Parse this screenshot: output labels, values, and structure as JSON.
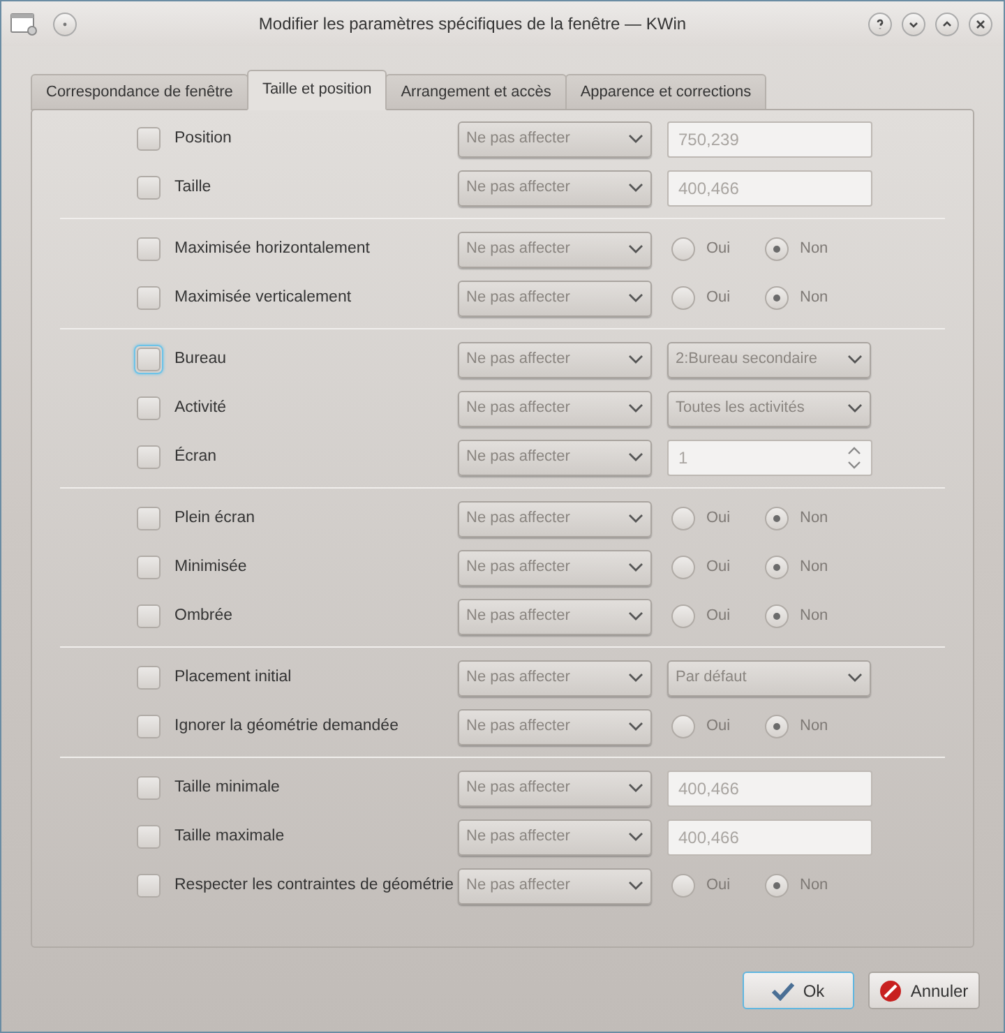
{
  "window": {
    "title": "Modifier les paramètres spécifiques de la fenêtre — KWin"
  },
  "tabs": [
    {
      "label": "Correspondance de fenêtre",
      "selected": false
    },
    {
      "label": "Taille et position",
      "selected": true
    },
    {
      "label": "Arrangement et accès",
      "selected": false
    },
    {
      "label": "Apparence et corrections",
      "selected": false
    }
  ],
  "groups": [
    {
      "rows": [
        {
          "label": "Position",
          "checked": false,
          "focused": false,
          "policy": "Ne pas affecter",
          "kind": "text",
          "value": "750,239"
        },
        {
          "label": "Taille",
          "checked": false,
          "focused": false,
          "policy": "Ne pas affecter",
          "kind": "text",
          "value": "400,466"
        }
      ]
    },
    {
      "rows": [
        {
          "label": "Maximisée horizontalement",
          "checked": false,
          "focused": false,
          "policy": "Ne pas affecter",
          "kind": "radio",
          "options": [
            {
              "label": "Oui",
              "selected": false
            },
            {
              "label": "Non",
              "selected": true
            }
          ]
        },
        {
          "label": "Maximisée verticalement",
          "checked": false,
          "focused": false,
          "policy": "Ne pas affecter",
          "kind": "radio",
          "options": [
            {
              "label": "Oui",
              "selected": false
            },
            {
              "label": "Non",
              "selected": true
            }
          ]
        }
      ]
    },
    {
      "rows": [
        {
          "label": "Bureau",
          "checked": false,
          "focused": true,
          "policy": "Ne pas affecter",
          "kind": "select",
          "value": "2:Bureau secondaire"
        },
        {
          "label": "Activité",
          "checked": false,
          "focused": false,
          "policy": "Ne pas affecter",
          "kind": "select",
          "value": "Toutes les activités"
        },
        {
          "label": "Écran",
          "checked": false,
          "focused": false,
          "policy": "Ne pas affecter",
          "kind": "spin",
          "value": "1"
        }
      ]
    },
    {
      "rows": [
        {
          "label": "Plein écran",
          "checked": false,
          "focused": false,
          "policy": "Ne pas affecter",
          "kind": "radio",
          "options": [
            {
              "label": "Oui",
              "selected": false
            },
            {
              "label": "Non",
              "selected": true
            }
          ]
        },
        {
          "label": "Minimisée",
          "checked": false,
          "focused": false,
          "policy": "Ne pas affecter",
          "kind": "radio",
          "options": [
            {
              "label": "Oui",
              "selected": false
            },
            {
              "label": "Non",
              "selected": true
            }
          ]
        },
        {
          "label": "Ombrée",
          "checked": false,
          "focused": false,
          "policy": "Ne pas affecter",
          "kind": "radio",
          "options": [
            {
              "label": "Oui",
              "selected": false
            },
            {
              "label": "Non",
              "selected": true
            }
          ]
        }
      ]
    },
    {
      "rows": [
        {
          "label": "Placement initial",
          "checked": false,
          "focused": false,
          "policy": "Ne pas affecter",
          "kind": "select",
          "value": "Par défaut"
        },
        {
          "label": "Ignorer la géométrie demandée",
          "checked": false,
          "focused": false,
          "policy": "Ne pas affecter",
          "kind": "radio",
          "options": [
            {
              "label": "Oui",
              "selected": false
            },
            {
              "label": "Non",
              "selected": true
            }
          ]
        }
      ]
    },
    {
      "rows": [
        {
          "label": "Taille minimale",
          "checked": false,
          "focused": false,
          "policy": "Ne pas affecter",
          "kind": "text",
          "value": "400,466"
        },
        {
          "label": "Taille maximale",
          "checked": false,
          "focused": false,
          "policy": "Ne pas affecter",
          "kind": "text",
          "value": "400,466"
        },
        {
          "label": "Respecter les contraintes de géométrie",
          "checked": false,
          "focused": false,
          "policy": "Ne pas affecter",
          "kind": "radio",
          "options": [
            {
              "label": "Oui",
              "selected": false
            },
            {
              "label": "Non",
              "selected": true
            }
          ]
        }
      ]
    }
  ],
  "buttons": [
    {
      "label": "Ok",
      "kind": "ok",
      "focused": true
    },
    {
      "label": "Annuler",
      "kind": "cancel",
      "focused": false
    }
  ]
}
